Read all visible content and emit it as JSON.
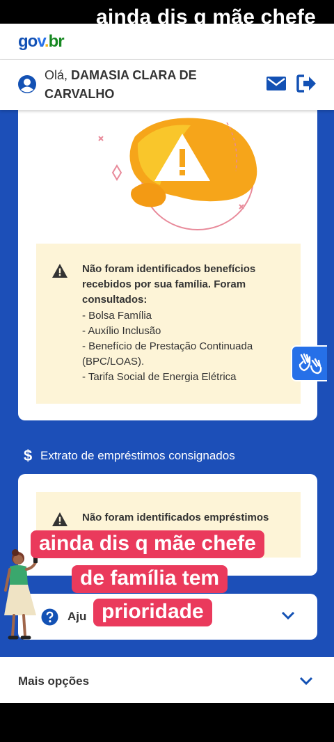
{
  "overlay": {
    "top_caption": "ainda dis q mãe chefe",
    "caption_lines": [
      "ainda dis q mãe chefe",
      "de família tem",
      "prioridade"
    ]
  },
  "header": {
    "logo_parts": [
      "go",
      "v",
      ".",
      "br"
    ],
    "greeting_prefix": "Olá, ",
    "user_name": "DAMASIA CLARA DE CARVALHO"
  },
  "benefits_card": {
    "alert_title": "Não foram identificados benefícios recebidos por sua família. Foram consultados:",
    "items": [
      "- Bolsa Família",
      "- Auxílio Inclusão",
      "- Benefício de Prestação Continuada (BPC/LOAS).",
      "- Tarifa Social de Energia Elétrica"
    ]
  },
  "loans_section": {
    "icon_glyph": "$",
    "title": "Extrato de empréstimos consignados",
    "alert_text": "Não foram identificados empréstimos"
  },
  "help_card": {
    "label": "Aju"
  },
  "more_options": {
    "label": "Mais opções"
  },
  "colors": {
    "brand_blue": "#1351b4",
    "page_background": "#1c4fb8",
    "alert_background": "#fdf4d7",
    "caption_background": "#ea3a5c"
  }
}
